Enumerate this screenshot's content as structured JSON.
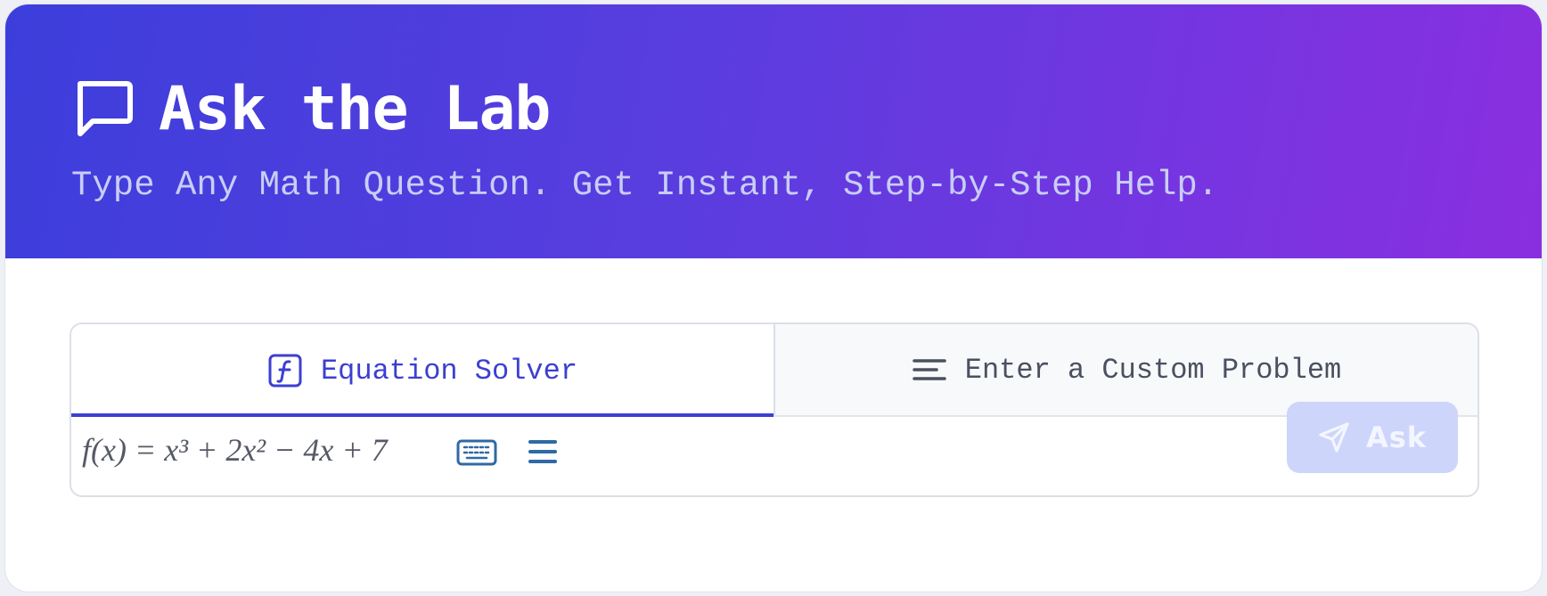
{
  "header": {
    "icon": "message-square-icon",
    "title": "Ask the Lab",
    "subtitle": "Type Any Math Question. Get Instant, Step-by-Step Help.",
    "gradient_start": "#3c3edb",
    "gradient_end": "#8a2fe0"
  },
  "tabs": [
    {
      "label": "Equation Solver",
      "icon": "function-icon",
      "active": true
    },
    {
      "label": "Enter a Custom Problem",
      "icon": "align-left-icon",
      "active": false
    }
  ],
  "input": {
    "formula_text": "f(x) = x³ + 2x² − 4x + 7",
    "keyboard_icon": "keyboard-icon",
    "menu_icon": "menu-icon"
  },
  "ask_button": {
    "label": "Ask",
    "icon": "send-icon",
    "state": "disabled"
  },
  "colors": {
    "accent": "#3c3fd1",
    "ask_button_bg": "#cdd5fb"
  }
}
